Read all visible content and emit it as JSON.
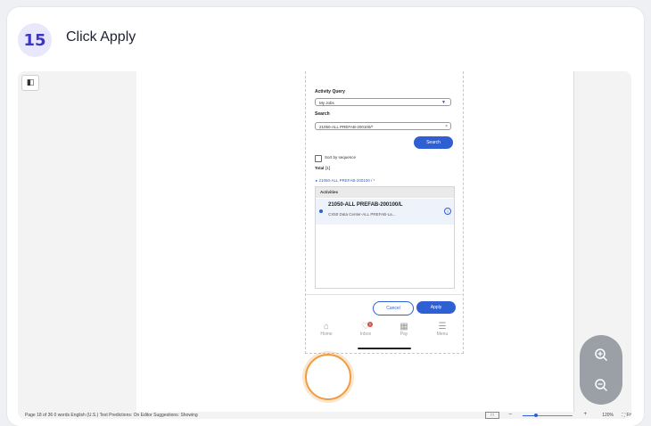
{
  "step": {
    "number": "15",
    "title": "Click Apply"
  },
  "phone": {
    "activity_query_label": "Activity Query",
    "activity_query_value": "My Jobs",
    "search_label": "Search",
    "search_value": "21050-ALL PREFAB-200100/*",
    "search_button": "Search",
    "sort_label": "Sort by sequence",
    "total_label": "Total",
    "total_count": "[1]",
    "breadcrumb": "21050-ALL PREFAB-200100 / *",
    "list_header": "Activities",
    "item_title": "21050-ALL PREFAB-200100/L",
    "item_subtitle": "CX50 Data Center-ALL PREFAB-La...",
    "cancel_button": "Cancel",
    "apply_button": "Apply",
    "nav": [
      {
        "label": "Home"
      },
      {
        "label": "Inbox",
        "badge": "1"
      },
      {
        "label": "Pay"
      },
      {
        "label": "Menu"
      }
    ]
  },
  "status_bar": {
    "left": "Page 18 of 36   0 words   English (U.S.)   Text Predictions: On   Editor Suggestions: Showing",
    "zoom_percent": "120%",
    "fit_label": "Fit",
    "zoom_minus": "–",
    "zoom_plus": "+"
  },
  "colors": {
    "accent": "#2e5fd3",
    "highlight_ring": "#f19a3e",
    "badge_bg": "#e9e7fb",
    "badge_fg": "#3b36c4"
  }
}
